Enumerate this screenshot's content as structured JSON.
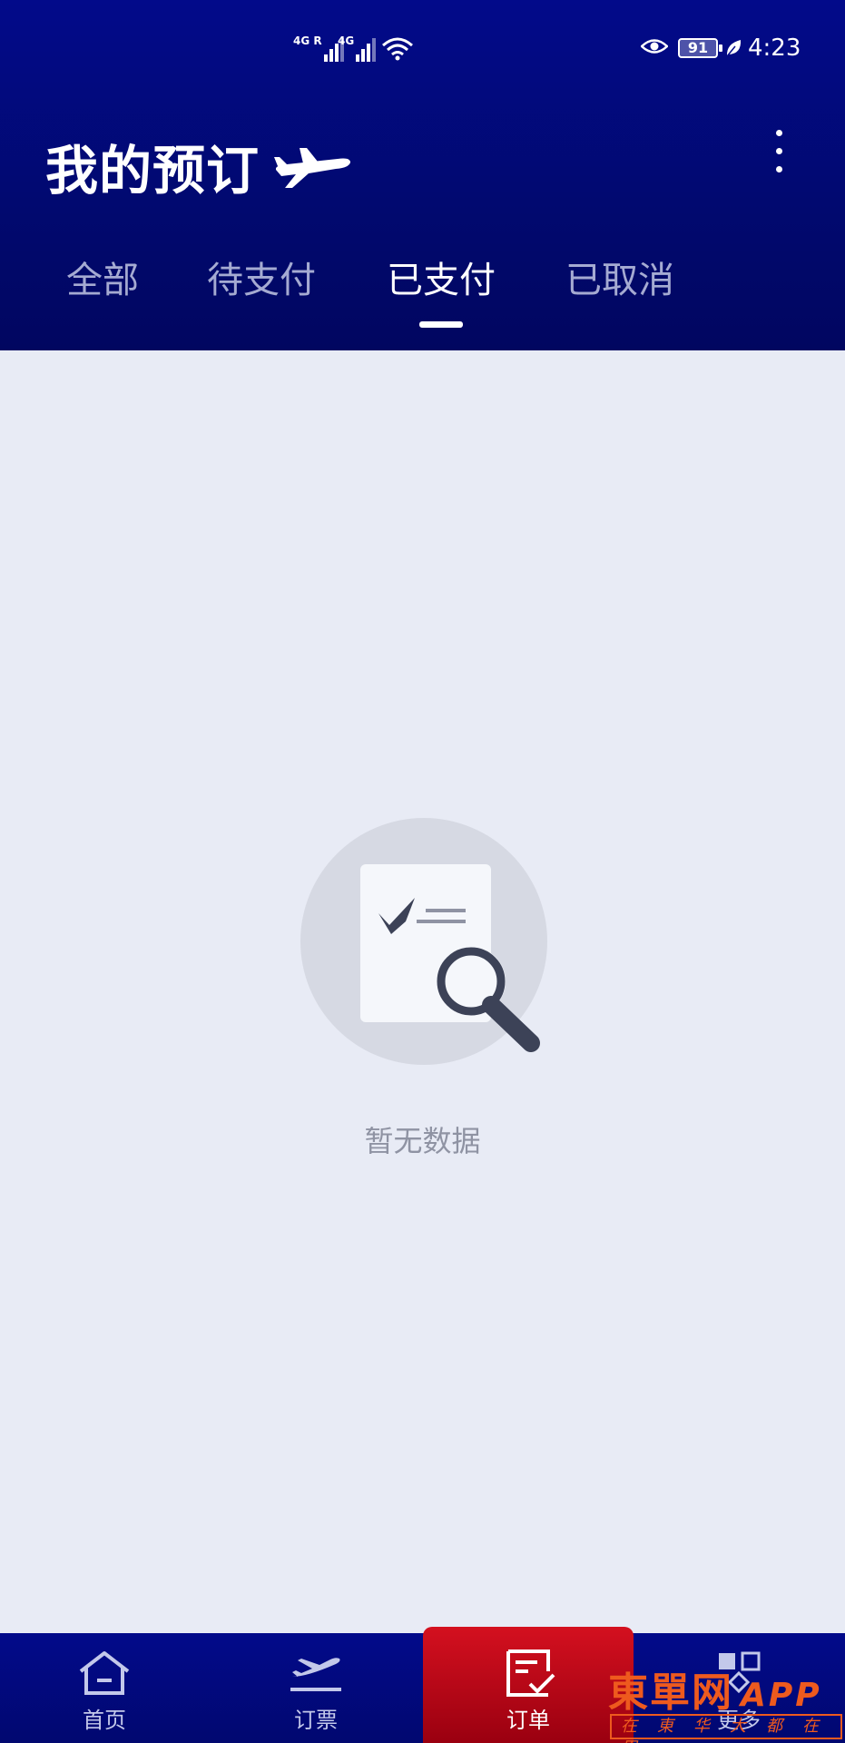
{
  "status_bar": {
    "signal1_tag": "4G R",
    "signal2_tag": "4G",
    "battery": "91",
    "time": "4:23"
  },
  "header": {
    "title": "我的预订"
  },
  "tabs": [
    {
      "label": "全部",
      "active": false
    },
    {
      "label": "待支付",
      "active": false
    },
    {
      "label": "已支付",
      "active": true
    },
    {
      "label": "已取消",
      "active": false
    }
  ],
  "empty_state": {
    "text": "暂无数据"
  },
  "bottom_nav": [
    {
      "label": "首页",
      "icon": "home-icon",
      "active": false
    },
    {
      "label": "订票",
      "icon": "flight-departure-icon",
      "active": false
    },
    {
      "label": "订单",
      "icon": "order-icon",
      "active": true
    },
    {
      "label": "更多",
      "icon": "grid-icon",
      "active": false
    }
  ],
  "watermark": {
    "main": "東單网",
    "latin": "APP",
    "sub": "在東华大都在用"
  },
  "colors": {
    "header_bg": "#020a8a",
    "active_tab": "#ffffff",
    "inactive_tab": "#c8cde8",
    "content_bg": "#e8ebf5",
    "nav_active_bg": "#d4101f",
    "watermark": "#ee5a1e"
  }
}
